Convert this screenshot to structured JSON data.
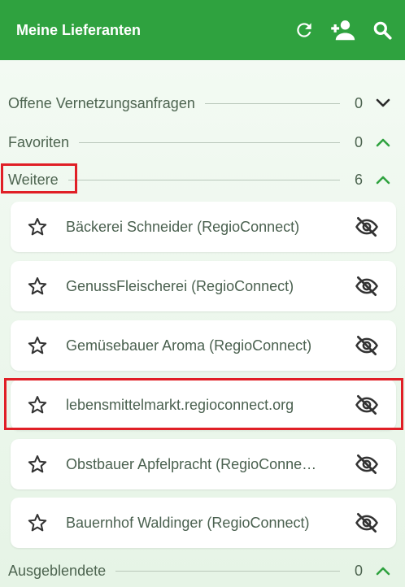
{
  "header": {
    "title": "Meine Lieferanten",
    "actions": [
      {
        "icon": "refresh-icon"
      },
      {
        "icon": "add-person-icon"
      },
      {
        "icon": "search-icon"
      }
    ]
  },
  "sections": {
    "pending": {
      "label": "Offene Vernetzungsanfragen",
      "count": "0",
      "chevron": "chevron-down-icon"
    },
    "favorites": {
      "label": "Favoriten",
      "count": "0",
      "chevron": "chevron-up-icon"
    },
    "more": {
      "label": "Weitere",
      "count": "6",
      "chevron": "chevron-up-icon"
    },
    "hidden": {
      "label": "Ausgeblendete",
      "count": "0",
      "chevron": "chevron-up-icon"
    }
  },
  "suppliers": [
    {
      "name": "Bäckerei Schneider (RegioConnect)"
    },
    {
      "name": "GenussFleischerei (RegioConnect)"
    },
    {
      "name": "Gemüsebauer Aroma (RegioConnect)"
    },
    {
      "name": "lebensmittelmarkt.regioconnect.org"
    },
    {
      "name": "Obstbauer Apfelpracht (RegioConne…"
    },
    {
      "name": "Bauernhof Waldinger (RegioConnect)"
    }
  ],
  "colors": {
    "appbar": "#2fa23f",
    "accent": "#2fa23f",
    "text": "#4d6450",
    "highlight": "#e01f26",
    "icon": "#333333"
  }
}
